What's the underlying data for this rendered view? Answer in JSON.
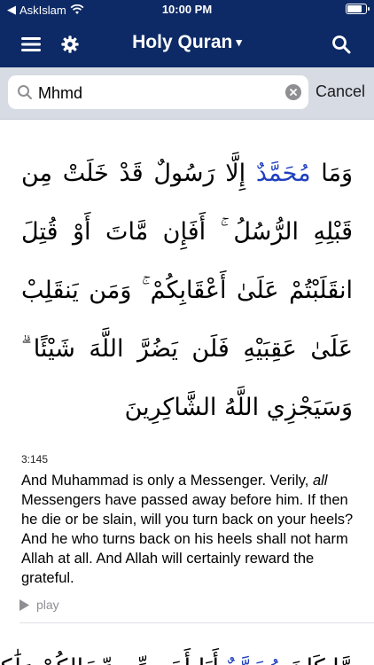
{
  "status_bar": {
    "carrier": "AskIslam",
    "time": "10:00 PM",
    "battery_level": 0.9
  },
  "nav": {
    "title": "Holy Quran",
    "title_caret": "▾",
    "menu_icon": "hamburger-icon",
    "settings_icon": "gear-icon",
    "search_icon": "search-icon",
    "bg_color": "#0d2a66"
  },
  "search": {
    "value": "Mhmd",
    "placeholder": "",
    "cancel_label": "Cancel"
  },
  "verses": [
    {
      "arabic_before": "وَمَا ",
      "arabic_highlight": "مُحَمَّدٌ",
      "arabic_after": " إِلَّا رَسُولٌ قَدْ خَلَتْ مِن قَبْلِهِ الرُّسُلُ ۚ أَفَإِن مَّاتَ أَوْ قُتِلَ انقَلَبْتُمْ عَلَىٰ أَعْقَابِكُمْ ۚ وَمَن يَنقَلِبْ عَلَىٰ عَقِبَيْهِ فَلَن يَضُرَّ اللَّهَ شَيْئًا ۗ وَسَيَجْزِي اللَّهُ الشَّاكِرِينَ",
      "ref": "3:145",
      "translation_before": "And Muhammad is only a Messenger. Verily, ",
      "translation_em": "all",
      "translation_after": " Messengers have passed away before him. If then he die or be slain, will you turn back on your heels? And he who turns back on his heels shall not harm Allah at all. And Allah will certainly reward the grateful.",
      "play_label": "play"
    },
    {
      "arabic_before": "مَّا كَانَ ",
      "arabic_highlight": "مُحَمَّدٌ",
      "arabic_after": " أَبَا أَحَدٍ مِّن رِّجَالِكُمْ وَلَٰكِن"
    }
  ]
}
